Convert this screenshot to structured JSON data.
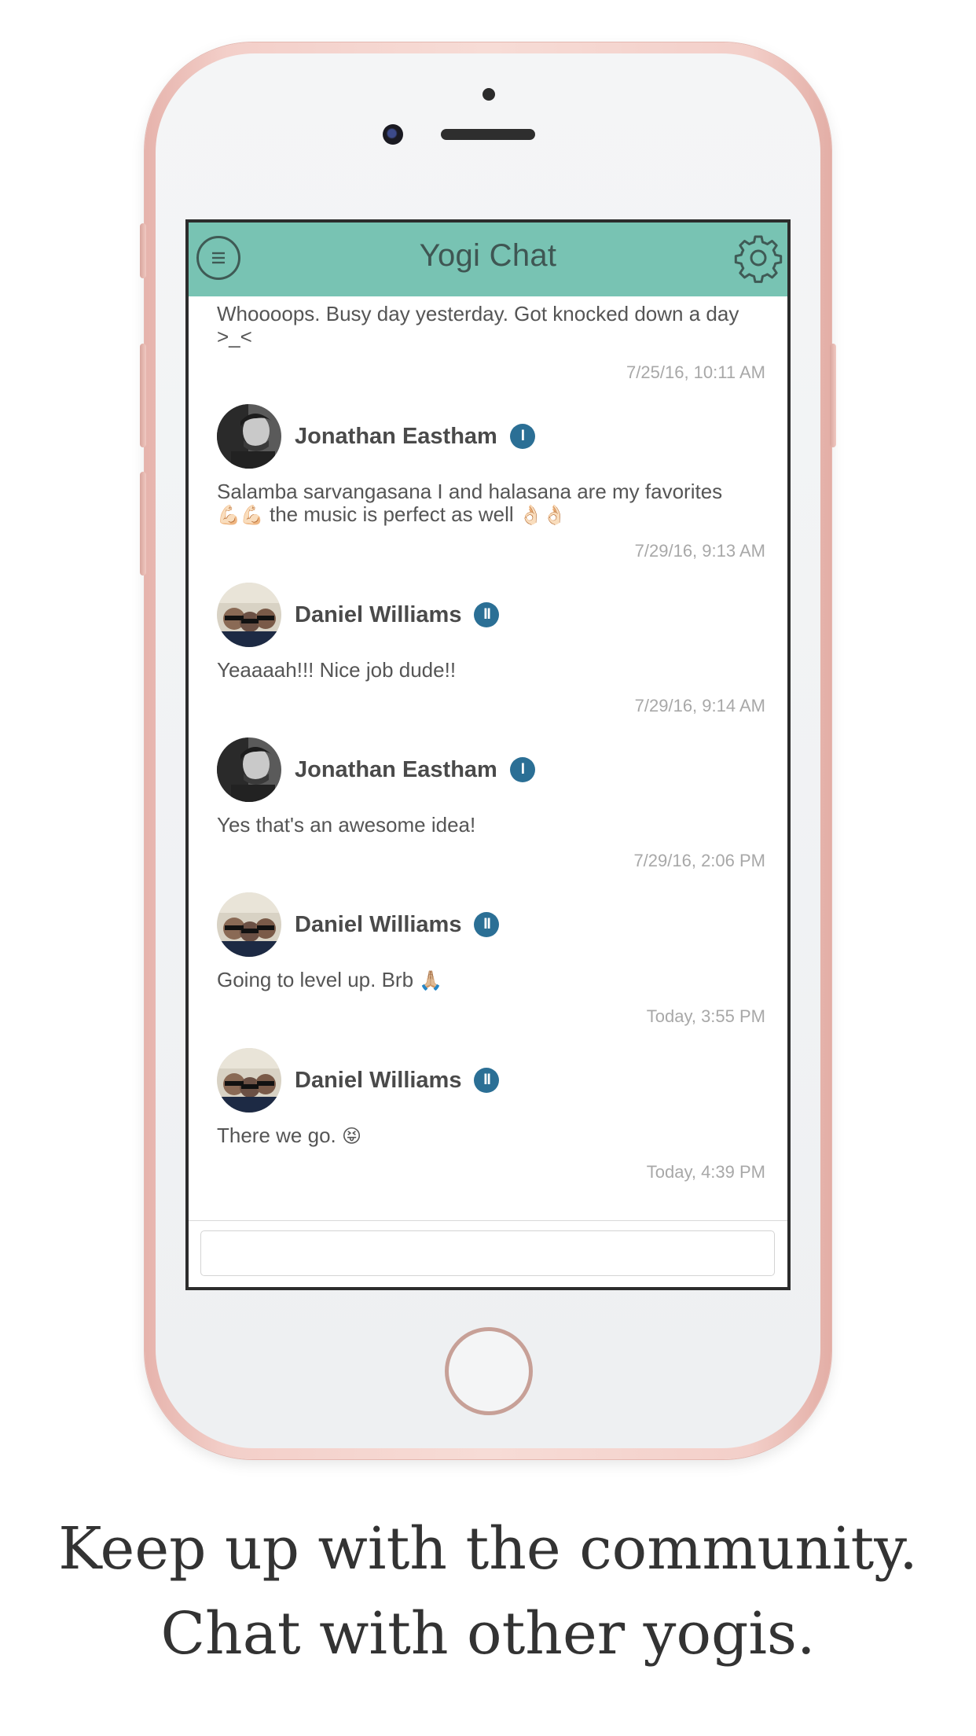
{
  "app": {
    "title": "Yogi Chat",
    "accent_color": "#78c3b3",
    "badge_color": "#2b6f95",
    "menu_icon": "hamburger-circle-icon",
    "settings_icon": "gear-icon"
  },
  "messages": [
    {
      "text": "Whoooops. Busy day yesterday. Got knocked down a day >_<",
      "time": "7/25/16, 10:11 AM"
    },
    {
      "sender": "Jonathan Eastham",
      "level": "I",
      "avatar": "avatar-jonathan",
      "text": "Salamba sarvangasana I and halasana are my favorites",
      "text2_pre": "💪🏻💪🏻",
      "text2": " the music is perfect as well ",
      "text2_post": "👌🏻👌🏻",
      "time": "7/29/16, 9:13 AM"
    },
    {
      "sender": "Daniel Williams",
      "level": "II",
      "avatar": "avatar-daniel",
      "text": "Yeaaaah!!! Nice job dude!!",
      "time": "7/29/16, 9:14 AM"
    },
    {
      "sender": "Jonathan Eastham",
      "level": "I",
      "avatar": "avatar-jonathan",
      "text": "Yes that's an awesome idea!",
      "time": "7/29/16, 2:06 PM"
    },
    {
      "sender": "Daniel Williams",
      "level": "II",
      "avatar": "avatar-daniel",
      "text": "Going to level up. Brb ",
      "emoji": "🙏🏼",
      "time": "Today, 3:55 PM"
    },
    {
      "sender": "Daniel Williams",
      "level": "II",
      "avatar": "avatar-daniel",
      "text": "There we go. ",
      "emoji": "😝",
      "time": "Today, 4:39 PM"
    }
  ],
  "input": {
    "value": "",
    "placeholder": ""
  },
  "caption": {
    "line1": "Keep up with the community.",
    "line2": "Chat with other yogis."
  }
}
